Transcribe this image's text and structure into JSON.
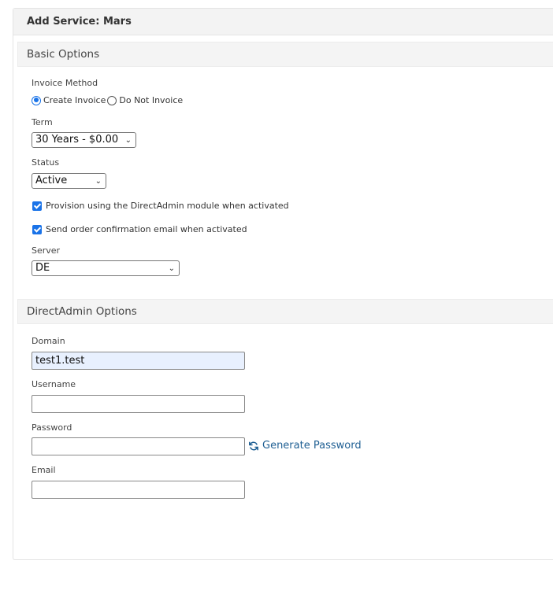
{
  "panel": {
    "title": "Add Service: Mars"
  },
  "basic": {
    "title": "Basic Options",
    "invoice_method": {
      "label": "Invoice Method",
      "options": [
        "Create Invoice",
        "Do Not Invoice"
      ],
      "selected": "Create Invoice"
    },
    "term": {
      "label": "Term",
      "value": "30 Years - $0.00"
    },
    "status": {
      "label": "Status",
      "value": "Active"
    },
    "provision": {
      "label": "Provision using the DirectAdmin module when activated",
      "checked": true
    },
    "send_email": {
      "label": "Send order confirmation email when activated",
      "checked": true
    },
    "server": {
      "label": "Server",
      "value": "DE"
    }
  },
  "directadmin": {
    "title": "DirectAdmin Options",
    "domain": {
      "label": "Domain",
      "value": "test1.test"
    },
    "username": {
      "label": "Username",
      "value": ""
    },
    "password": {
      "label": "Password",
      "value": ""
    },
    "generate": {
      "label": "Generate Password",
      "icon": "refresh-icon"
    },
    "email": {
      "label": "Email",
      "value": ""
    }
  },
  "colors": {
    "accent": "#1a73e8",
    "link": "#1f5f93",
    "autofill": "#e8f0fe"
  }
}
